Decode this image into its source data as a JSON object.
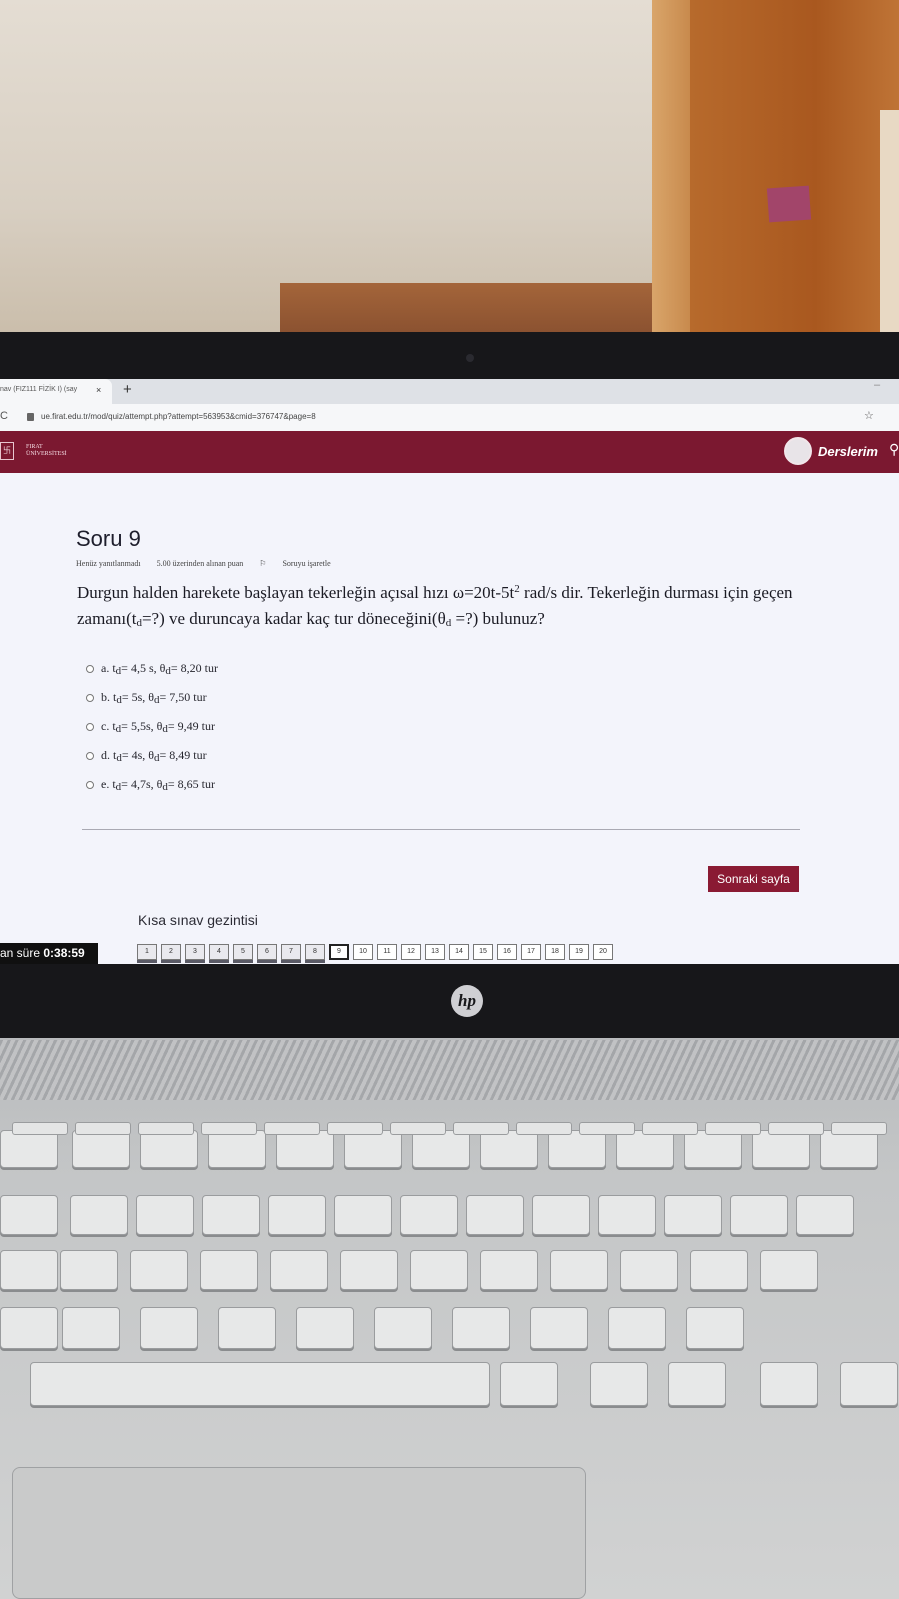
{
  "browser": {
    "tab_title": "nav (FIZ111 FİZİK I) (say",
    "tab_close": "×",
    "new_tab": "+",
    "url": "ue.firat.edu.tr/mod/quiz/attempt.php?attempt=563953&cmid=376747&page=8"
  },
  "header": {
    "logo_lines": [
      "FIRAT",
      "ÜNİVERSİTESİ"
    ],
    "my_courses": "Derslerim"
  },
  "question": {
    "title": "Soru 9",
    "status": "Henüz yanıtlanmadı",
    "grade": "5.00 üzerinden alınan puan",
    "flag": "Soruyu işaretle",
    "text_part1": "Durgun halden harekete başlayan tekerleğin açısal hızı  ω=20t-5t",
    "sup": "2",
    "text_part2": " rad/s dir. Tekerleğin durması için geçen zamanı(t",
    "sub1": "d",
    "text_part3": "=?) ve duruncaya kadar kaç tur döneceğini(θ",
    "sub2": "d",
    "text_part4": " =?) bulunuz?",
    "options": [
      {
        "prefix": "a. t",
        "sub": "d",
        "mid": "= 4,5 s,  θ",
        "sub2": "d",
        "suffix": "= 8,20 tur"
      },
      {
        "prefix": "b. t",
        "sub": "d",
        "mid": "= 5s,  θ",
        "sub2": "d",
        "suffix": "= 7,50 tur"
      },
      {
        "prefix": "c. t",
        "sub": "d",
        "mid": "= 5,5s,  θ",
        "sub2": "d",
        "suffix": "= 9,49 tur"
      },
      {
        "prefix": "d. t",
        "sub": "d",
        "mid": "= 4s,  θ",
        "sub2": "d",
        "suffix": "= 8,49 tur"
      },
      {
        "prefix": "e. t",
        "sub": "d",
        "mid": "= 4,7s,  θ",
        "sub2": "d",
        "suffix": "= 8,65 tur"
      }
    ]
  },
  "next_button": "Sonraki sayfa",
  "navigation": {
    "title": "Kısa sınav gezintisi",
    "timer_label": "an süre ",
    "timer_value": "0:38:59",
    "pages": [
      "1",
      "2",
      "3",
      "4",
      "5",
      "6",
      "7",
      "8",
      "9",
      "10",
      "11",
      "12",
      "13",
      "14",
      "15",
      "16",
      "17",
      "18",
      "19",
      "20"
    ],
    "answered_pages": 8,
    "current_page": "9"
  },
  "laptop": {
    "brand": "hp"
  },
  "colors": {
    "header": "#7b1830",
    "button": "#8a1a33"
  }
}
